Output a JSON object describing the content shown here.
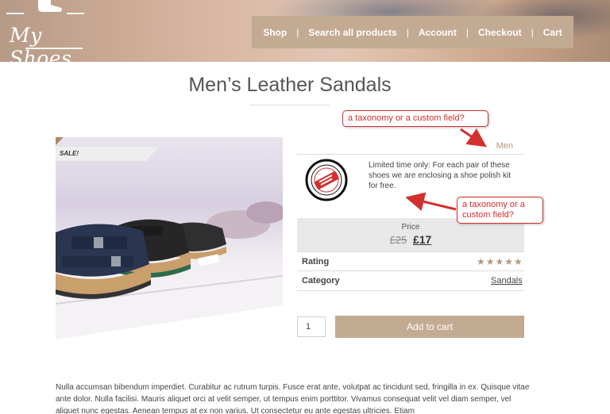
{
  "brand": {
    "logo_text": "My Shoes"
  },
  "nav": {
    "items": [
      "Shop",
      "Search all products",
      "Account",
      "Checkout",
      "Cart"
    ],
    "separator": "|"
  },
  "product": {
    "title": "Men’s Leather Sandals",
    "sale_badge": "SALE!",
    "gender_term": "Men",
    "offer_text": "Limited time only: For each pair of these shoes we are enclosing a shoe polish kit for free.",
    "price_label": "Price",
    "price_old": "£25",
    "price_new": "£17",
    "rating_label": "Rating",
    "rating_stars": "★★★★★",
    "category_label": "Category",
    "category_value": "Sandals",
    "quantity": "1",
    "add_to_cart": "Add to cart",
    "description": "Nulla accumsan bibendum imperdiet. Curabitur ac rutrum turpis. Fusce erat ante, volutpat ac tincidunt sed, fringilla in ex. Quisque vitae ante dolor. Nulla facilisi. Mauris aliquet orci at velit semper, ut tempus enim porttitor. Vivamus consequat velit vel diam semper, vel aliquet nunc egestas. Aenean tempus at ex non varius. Ut consectetur eu ante egestas ultricies. Etiam"
  },
  "annotations": {
    "callout_1": "a taxonomy or a custom field?",
    "callout_2_line1": "a taxonomy or a",
    "callout_2_line2": "custom field?"
  },
  "colors": {
    "accent": "#c3aa92",
    "annotation": "#d32f2f"
  }
}
